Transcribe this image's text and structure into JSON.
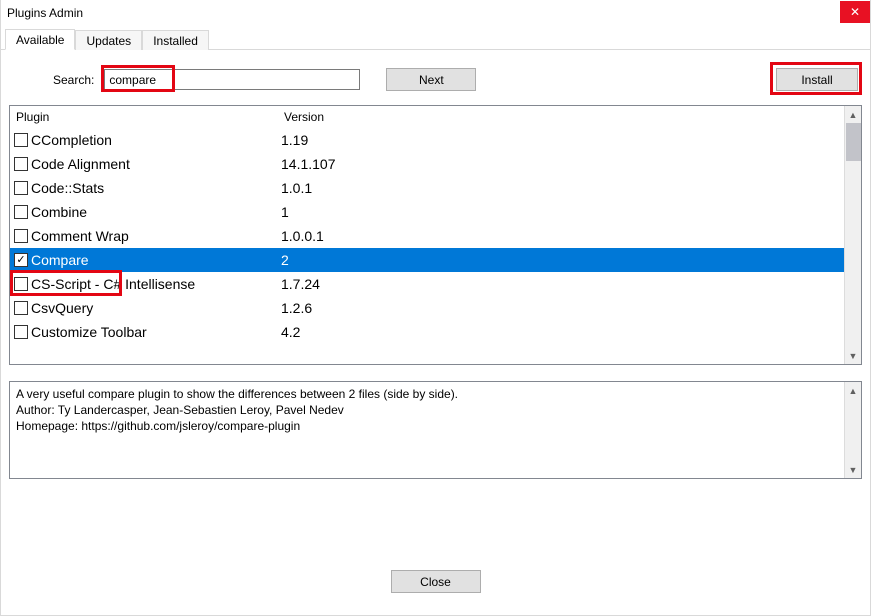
{
  "window": {
    "title": "Plugins Admin",
    "close_glyph": "✕"
  },
  "tabs": {
    "available": "Available",
    "updates": "Updates",
    "installed": "Installed"
  },
  "search": {
    "label": "Search:",
    "value": "compare",
    "next_label": "Next",
    "install_label": "Install"
  },
  "list": {
    "header_plugin": "Plugin",
    "header_version": "Version",
    "rows": [
      {
        "name": "CCompletion",
        "version": "1.19",
        "checked": false,
        "selected": false
      },
      {
        "name": "Code Alignment",
        "version": "14.1.107",
        "checked": false,
        "selected": false
      },
      {
        "name": "Code::Stats",
        "version": "1.0.1",
        "checked": false,
        "selected": false
      },
      {
        "name": "Combine",
        "version": "1",
        "checked": false,
        "selected": false
      },
      {
        "name": "Comment Wrap",
        "version": "1.0.0.1",
        "checked": false,
        "selected": false
      },
      {
        "name": "Compare",
        "version": "2",
        "checked": true,
        "selected": true
      },
      {
        "name": "CS-Script - C# Intellisense",
        "version": "1.7.24",
        "checked": false,
        "selected": false
      },
      {
        "name": "CsvQuery",
        "version": "1.2.6",
        "checked": false,
        "selected": false
      },
      {
        "name": "Customize Toolbar",
        "version": "4.2",
        "checked": false,
        "selected": false
      }
    ]
  },
  "description": {
    "line1": "A very useful compare plugin to show the differences between 2 files (side by side).",
    "line2": "Author: Ty Landercasper, Jean-Sebastien Leroy, Pavel Nedev",
    "line3": "Homepage: https://github.com/jsleroy/compare-plugin"
  },
  "buttons": {
    "close": "Close"
  },
  "glyphs": {
    "up": "▲",
    "down": "▼",
    "check": "✓"
  }
}
